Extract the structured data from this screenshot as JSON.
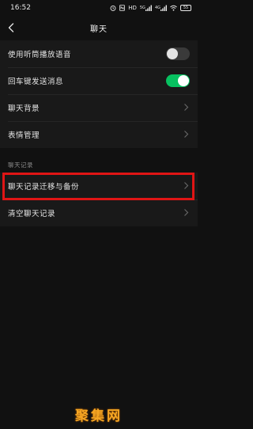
{
  "status_bar": {
    "time": "16:52",
    "network": "HD",
    "signal_1": "5G",
    "signal_2": "4G",
    "battery": "55"
  },
  "nav": {
    "title": "聊天"
  },
  "settings_group_1": {
    "items": [
      {
        "label": "使用听筒播放语音",
        "toggle": false
      },
      {
        "label": "回车键发送消息",
        "toggle": true
      },
      {
        "label": "聊天背景"
      },
      {
        "label": "表情管理"
      }
    ]
  },
  "chat_history": {
    "section_title": "聊天记录",
    "items": [
      {
        "label": "聊天记录迁移与备份"
      },
      {
        "label": "清空聊天记录"
      }
    ]
  },
  "watermark": "聚集网",
  "colors": {
    "background": "#111111",
    "cell": "#191919",
    "toggle_on": "#07c160",
    "highlight": "#e01515",
    "watermark": "#f5a623"
  }
}
